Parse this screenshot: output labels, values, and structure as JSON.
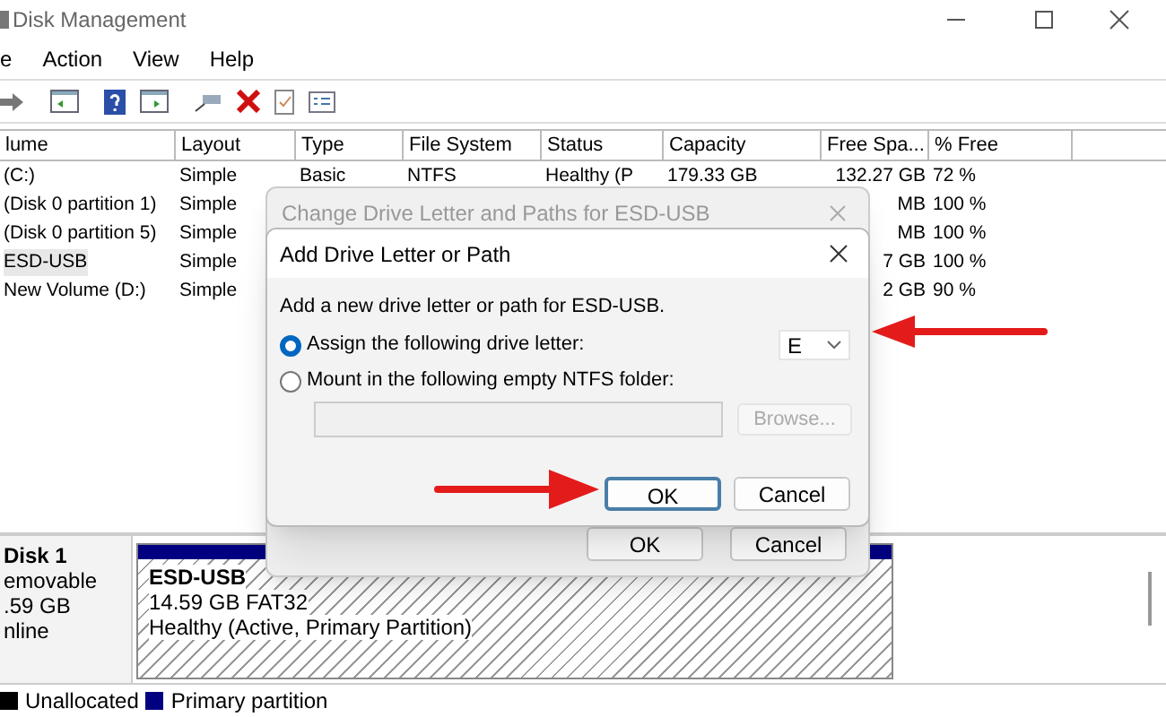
{
  "window": {
    "title": "Disk Management"
  },
  "menu": [
    "e",
    "Action",
    "View",
    "Help"
  ],
  "table": {
    "columns": [
      "lume",
      "Layout",
      "Type",
      "File System",
      "Status",
      "Capacity",
      "Free Spa...",
      "% Free"
    ],
    "rows": [
      {
        "cells": [
          "(C:)",
          "Simple",
          "Basic",
          "NTFS",
          "Healthy (P",
          "179.33 GB",
          "132.27 GB",
          "72 %"
        ],
        "selected": false
      },
      {
        "cells": [
          "(Disk 0 partition 1)",
          "Simple",
          "",
          "",
          "",
          "",
          "MB",
          "100 %"
        ],
        "selected": false
      },
      {
        "cells": [
          "(Disk 0 partition 5)",
          "Simple",
          "",
          "",
          "",
          "",
          "MB",
          "100 %"
        ],
        "selected": false
      },
      {
        "cells": [
          "ESD-USB",
          "Simple",
          "",
          "",
          "",
          "",
          "7 GB",
          "100 %"
        ],
        "selected": true
      },
      {
        "cells": [
          "New Volume (D:)",
          "Simple",
          "",
          "",
          "",
          "",
          "2 GB",
          "90 %"
        ],
        "selected": false
      }
    ]
  },
  "disk": {
    "name": "Disk 1",
    "lines": [
      "emovable",
      ".59 GB",
      "nline"
    ],
    "partition": {
      "name": "ESD-USB",
      "size": "14.59 GB FAT32",
      "status": "Healthy (Active, Primary Partition)"
    }
  },
  "legend": [
    {
      "label": "Unallocated",
      "color": "#000000"
    },
    {
      "label": "Primary partition",
      "color": "#000080"
    }
  ],
  "outer_dialog": {
    "title": "Change Drive Letter and Paths for ESD-USB",
    "active": false,
    "buttons": [
      {
        "label": "OK",
        "default": false
      },
      {
        "label": "Cancel",
        "default": false
      }
    ]
  },
  "dialog": {
    "title": "Add Drive Letter or Path",
    "active": true,
    "intro": "Add a new drive letter or path for ESD-USB.",
    "options": [
      {
        "label": "Assign the following drive letter:",
        "selected": true
      },
      {
        "label": "Mount in the following empty NTFS folder:",
        "selected": false
      }
    ],
    "drive_letter": "E",
    "folder_field": {
      "disabled": true
    },
    "browse": {
      "label": "Browse...",
      "disabled": true
    },
    "buttons": [
      {
        "label": "OK",
        "default": true
      },
      {
        "label": "Cancel",
        "default": false
      }
    ]
  }
}
